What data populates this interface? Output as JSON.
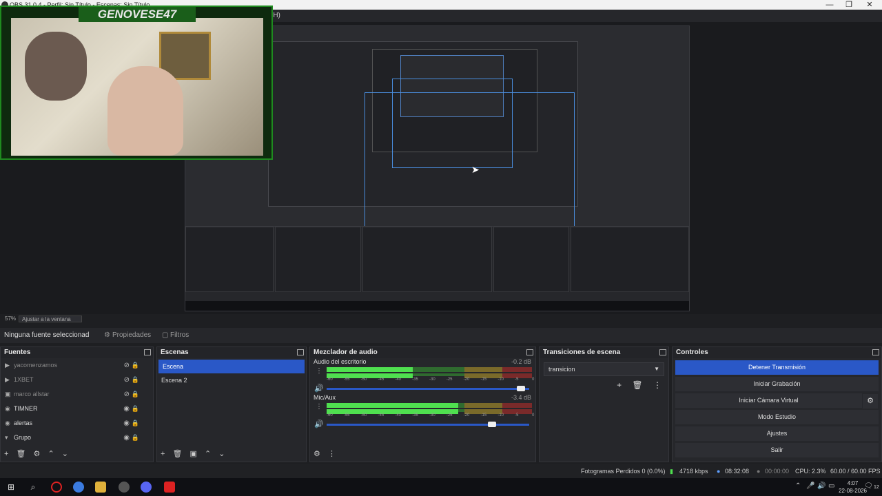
{
  "window": {
    "title": "OBS 31.0.4 - Perfil: Sin Título - Escenas: Sin Título",
    "menu_hint": "(H)",
    "minimize": "—",
    "restore": "❐",
    "close": "✕"
  },
  "overlay": {
    "logo_text": "GENOVESE47"
  },
  "preview": {
    "zoom_percent": "57%",
    "zoom_mode": "Ajustar a la ventana"
  },
  "properties_bar": {
    "no_source": "Ninguna fuente seleccionad",
    "tab_properties": "Propiedades",
    "tab_filters": "Filtros"
  },
  "sources": {
    "title": "Fuentes",
    "items": [
      {
        "label": "yacomenzamos",
        "icon": "play-icon",
        "hidden": true
      },
      {
        "label": "1XBET",
        "icon": "play-icon",
        "hidden": true
      },
      {
        "label": "marco allstar",
        "icon": "image-icon",
        "hidden": true
      },
      {
        "label": "TIMNER",
        "icon": "browser-icon",
        "hidden": false
      },
      {
        "label": "alertas",
        "icon": "browser-icon",
        "hidden": false
      },
      {
        "label": "Grupo",
        "icon": "folder-icon",
        "hidden": false
      }
    ]
  },
  "scenes": {
    "title": "Escenas",
    "items": [
      {
        "label": "Escena",
        "active": true
      },
      {
        "label": "Escena 2",
        "active": false
      }
    ]
  },
  "mixer": {
    "title": "Mezclador de audio",
    "channels": [
      {
        "name": "Audio del escritorio",
        "db": "-0.2 dB",
        "level_fraction": 0.42,
        "volume_fraction": 0.98
      },
      {
        "name": "Mic/Aux",
        "db": "-3.4 dB",
        "level_fraction": 0.64,
        "volume_fraction": 0.83
      }
    ],
    "scale": [
      "-60",
      "-55",
      "-50",
      "-45",
      "-40",
      "-35",
      "-30",
      "-25",
      "-20",
      "-15",
      "-10",
      "-5",
      "0"
    ]
  },
  "transitions": {
    "title": "Transiciones de escena",
    "selected": "transicion"
  },
  "controls": {
    "title": "Controles",
    "buttons": [
      "Detener Transmisión",
      "Iniciar Grabación",
      "Iniciar Cámara Virtual",
      "Modo Estudio",
      "Ajustes",
      "Salir"
    ]
  },
  "status": {
    "dropped": "Fotogramas Perdidos 0 (0.0%)",
    "bitrate": "4718 kbps",
    "stream_time": "08:32:08",
    "rec_time": "00:00:00",
    "cpu": "CPU: 2.3%",
    "fps": "60.00 / 60.00 FPS"
  },
  "taskbar": {
    "time": "4:07",
    "date": "22-08-2026",
    "notifications": "12"
  },
  "colors": {
    "accent": "#2a58c7",
    "meter_green": "#4fe04f",
    "overlay_green": "#1f8a1f"
  }
}
